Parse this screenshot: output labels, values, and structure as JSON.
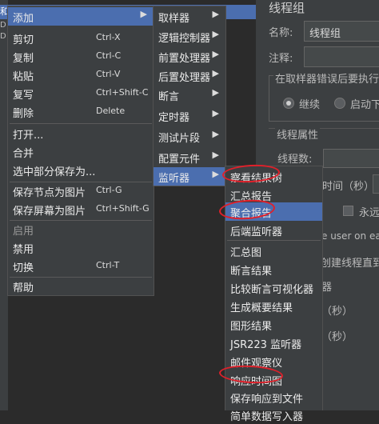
{
  "bg": {
    "tree_fragment_1": "和",
    "tree_fragment_2": "D",
    "tree_fragment_3": "D",
    "panel_title": "线程组",
    "name_label": "名称:",
    "name_value": "线程组",
    "comment_label": "注释:",
    "error_group_title": "在取样器错误后要执行的",
    "radio_continue": "继续",
    "radio_start_next": "启动下",
    "thread_props_title": "线程属性",
    "thread_count_label": "线程数:",
    "ramp_up_partial": "时间（秒）:",
    "forever_partial": "永远",
    "same_user_partial": "e user on eac",
    "delay_create_partial": "创建线程直到",
    "frag_qi": "器",
    "frag_sec1": "（秒）",
    "frag_sec2": "（秒）"
  },
  "menu1": {
    "items": [
      {
        "label": "添加",
        "submenu": true,
        "selected": true
      },
      {
        "label": "剪切",
        "shortcut": "Ctrl-X"
      },
      {
        "label": "复制",
        "shortcut": "Ctrl-C"
      },
      {
        "label": "粘贴",
        "shortcut": "Ctrl-V"
      },
      {
        "label": "复写",
        "shortcut": "Ctrl+Shift-C"
      },
      {
        "label": "删除",
        "shortcut": "Delete"
      },
      {
        "label": "打开..."
      },
      {
        "label": "合并"
      },
      {
        "label": "选中部分保存为..."
      },
      {
        "label": "保存节点为图片",
        "shortcut": "Ctrl-G"
      },
      {
        "label": "保存屏幕为图片",
        "shortcut": "Ctrl+Shift-G"
      },
      {
        "label": "启用",
        "disabled": true
      },
      {
        "label": "禁用"
      },
      {
        "label": "切换",
        "shortcut": "Ctrl-T"
      },
      {
        "label": "帮助"
      }
    ]
  },
  "menu2": {
    "items": [
      {
        "label": "取样器"
      },
      {
        "label": "逻辑控制器"
      },
      {
        "label": "前置处理器"
      },
      {
        "label": "后置处理器"
      },
      {
        "label": "断言"
      },
      {
        "label": "定时器"
      },
      {
        "label": "测试片段"
      },
      {
        "label": "配置元件"
      },
      {
        "label": "监听器",
        "selected": true
      }
    ]
  },
  "menu3": {
    "items": [
      {
        "label": "察看结果树"
      },
      {
        "label": "汇总报告"
      },
      {
        "label": "聚合报告",
        "selected": true
      },
      {
        "label": "后端监听器"
      },
      {
        "label": "汇总图"
      },
      {
        "label": "断言结果"
      },
      {
        "label": "比较断言可视化器"
      },
      {
        "label": "生成概要结果"
      },
      {
        "label": "图形结果"
      },
      {
        "label": "JSR223 监听器"
      },
      {
        "label": "邮件观察仪"
      },
      {
        "label": "响应时间图"
      },
      {
        "label": "保存响应到文件"
      },
      {
        "label": "简单数据写入器"
      }
    ]
  },
  "colors": {
    "selection": "#4b6eaf",
    "menu_bg": "#3c3f41",
    "annotation": "#e0202a"
  }
}
